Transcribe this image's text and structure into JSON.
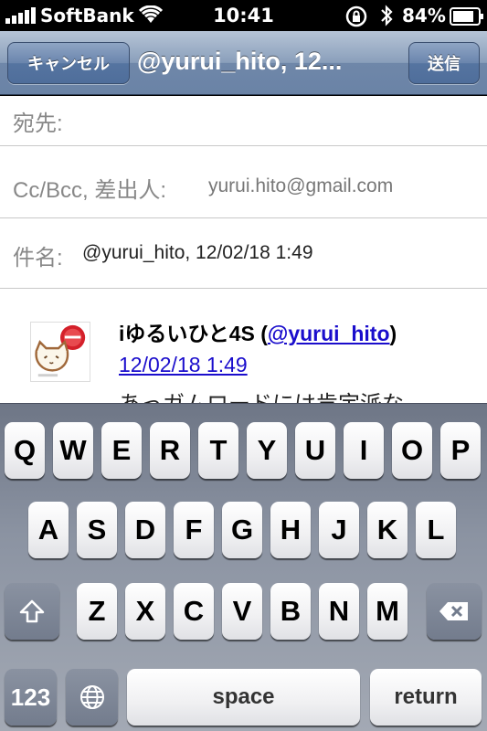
{
  "status_bar": {
    "carrier": "SoftBank",
    "time": "10:41",
    "battery_percent": "84%"
  },
  "nav": {
    "cancel_label": "キャンセル",
    "title": "@yurui_hito, 12...",
    "send_label": "送信"
  },
  "fields": {
    "to_label": "宛先:",
    "cc_label": "Cc/Bcc, 差出人:",
    "cc_value": "yurui.hito@gmail.com",
    "subject_label": "件名:",
    "subject_value": "@yurui_hito, 12/02/18 1:49"
  },
  "message": {
    "author_name": "iゆるいひと4S (",
    "author_handle": "@yurui_hito",
    "author_close": ")",
    "date_link": "12/02/18 1:49",
    "text_partial": "あっガムロードには肯定派な"
  },
  "keyboard": {
    "row1": [
      "Q",
      "W",
      "E",
      "R",
      "T",
      "Y",
      "U",
      "I",
      "O",
      "P"
    ],
    "row2": [
      "A",
      "S",
      "D",
      "F",
      "G",
      "H",
      "J",
      "K",
      "L"
    ],
    "row3": [
      "Z",
      "X",
      "C",
      "V",
      "B",
      "N",
      "M"
    ],
    "num_label": "123",
    "space_label": "space",
    "return_label": "return"
  },
  "colors": {
    "nav_accent": "#6a83a6",
    "link": "#1a0dcc"
  }
}
